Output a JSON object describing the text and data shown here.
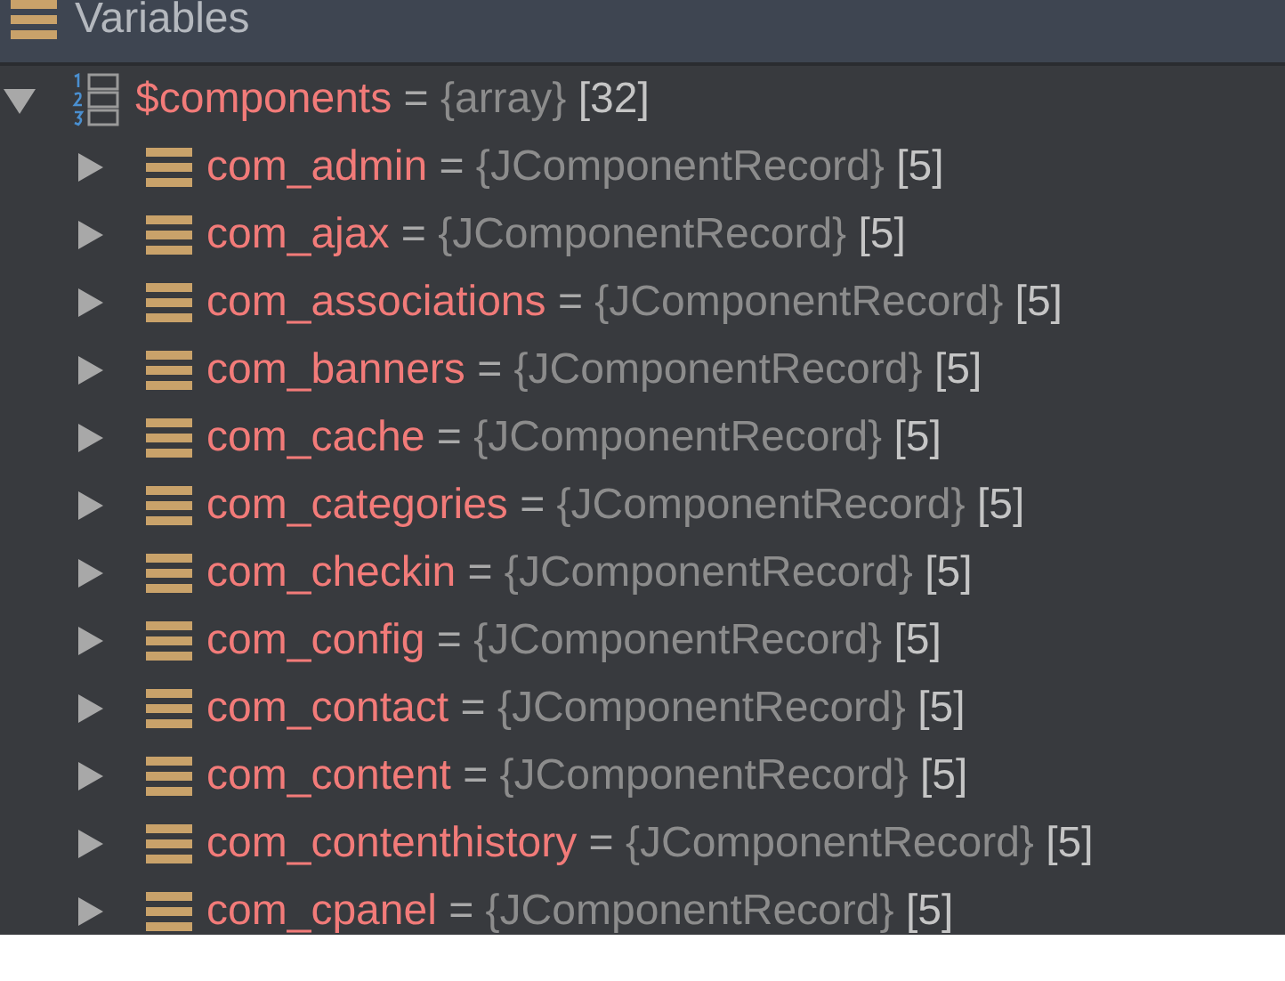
{
  "panel": {
    "title": "Variables"
  },
  "tree": [
    {
      "name": "$components",
      "separator": "=",
      "type": "{array}",
      "count": "[32]",
      "kind": "array",
      "expanded": true,
      "children": [
        {
          "name": "com_admin",
          "separator": "=",
          "type": "{JComponentRecord}",
          "count": "[5]",
          "kind": "object",
          "expanded": false
        },
        {
          "name": "com_ajax",
          "separator": "=",
          "type": "{JComponentRecord}",
          "count": "[5]",
          "kind": "object",
          "expanded": false
        },
        {
          "name": "com_associations",
          "separator": "=",
          "type": "{JComponentRecord}",
          "count": "[5]",
          "kind": "object",
          "expanded": false
        },
        {
          "name": "com_banners",
          "separator": "=",
          "type": "{JComponentRecord}",
          "count": "[5]",
          "kind": "object",
          "expanded": false
        },
        {
          "name": "com_cache",
          "separator": "=",
          "type": "{JComponentRecord}",
          "count": "[5]",
          "kind": "object",
          "expanded": false
        },
        {
          "name": "com_categories",
          "separator": "=",
          "type": "{JComponentRecord}",
          "count": "[5]",
          "kind": "object",
          "expanded": false
        },
        {
          "name": "com_checkin",
          "separator": "=",
          "type": "{JComponentRecord}",
          "count": "[5]",
          "kind": "object",
          "expanded": false
        },
        {
          "name": "com_config",
          "separator": "=",
          "type": "{JComponentRecord}",
          "count": "[5]",
          "kind": "object",
          "expanded": false
        },
        {
          "name": "com_contact",
          "separator": "=",
          "type": "{JComponentRecord}",
          "count": "[5]",
          "kind": "object",
          "expanded": false
        },
        {
          "name": "com_content",
          "separator": "=",
          "type": "{JComponentRecord}",
          "count": "[5]",
          "kind": "object",
          "expanded": false
        },
        {
          "name": "com_contenthistory",
          "separator": "=",
          "type": "{JComponentRecord}",
          "count": "[5]",
          "kind": "object",
          "expanded": false
        },
        {
          "name": "com_cpanel",
          "separator": "=",
          "type": "{JComponentRecord}",
          "count": "[5]",
          "kind": "object",
          "expanded": false
        }
      ]
    }
  ]
}
